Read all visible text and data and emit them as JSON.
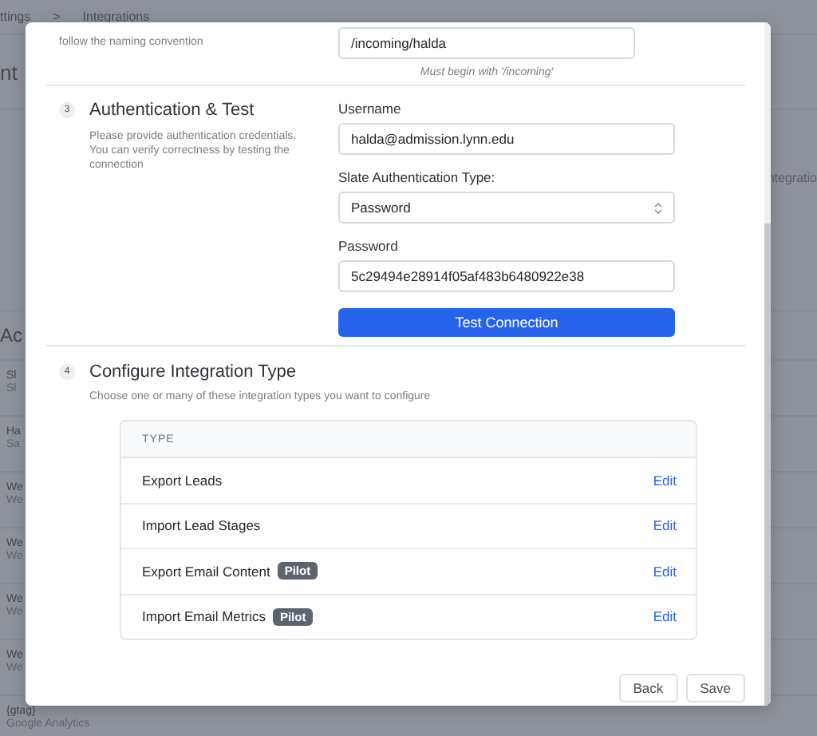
{
  "background": {
    "breadcrumb": [
      "ttings",
      ">",
      "Integrations"
    ],
    "heading": "nt",
    "side_text": "ntegratio",
    "section_heading": "Ac",
    "items": [
      {
        "title": "Sl",
        "subtitle": "Sl"
      },
      {
        "title": "Ha",
        "subtitle": "Sa"
      },
      {
        "title": "We",
        "subtitle": "We"
      },
      {
        "title": "We",
        "subtitle": "We"
      },
      {
        "title": "We",
        "subtitle": "We"
      },
      {
        "title": "We",
        "subtitle": "We"
      },
      {
        "title": "{gtag}",
        "subtitle": "Google Analytics"
      }
    ]
  },
  "modal": {
    "path_section": {
      "description": "follow the naming convention",
      "value": "/incoming/halda",
      "hint": "Must begin with '/incoming'"
    },
    "auth_section": {
      "number": "3",
      "title": "Authentication & Test",
      "description": "Please provide authentication credentials. You can verify correctness by testing the connection",
      "fields": [
        {
          "kind": "text",
          "label": "Username",
          "value": "halda@admission.lynn.edu"
        },
        {
          "kind": "select",
          "label": "Slate Authentication Type:",
          "value": "Password"
        },
        {
          "kind": "text",
          "label": "Password",
          "value": "5c29494e28914f05af483b6480922e38"
        }
      ],
      "button": "Test Connection"
    },
    "type_section": {
      "number": "4",
      "title": "Configure Integration Type",
      "description": "Choose one or many of these integration types you want to configure",
      "table": {
        "columns": [
          "TYPE"
        ],
        "rows": [
          {
            "name": "Export Leads",
            "action": "Edit"
          },
          {
            "name": "Import Lead Stages",
            "action": "Edit"
          },
          {
            "name": "Export Email Content",
            "badge": "Pilot",
            "action": "Edit"
          },
          {
            "name": "Import Email Metrics",
            "badge": "Pilot",
            "action": "Edit"
          }
        ]
      }
    },
    "buttons": [
      "Back",
      "Save"
    ]
  }
}
